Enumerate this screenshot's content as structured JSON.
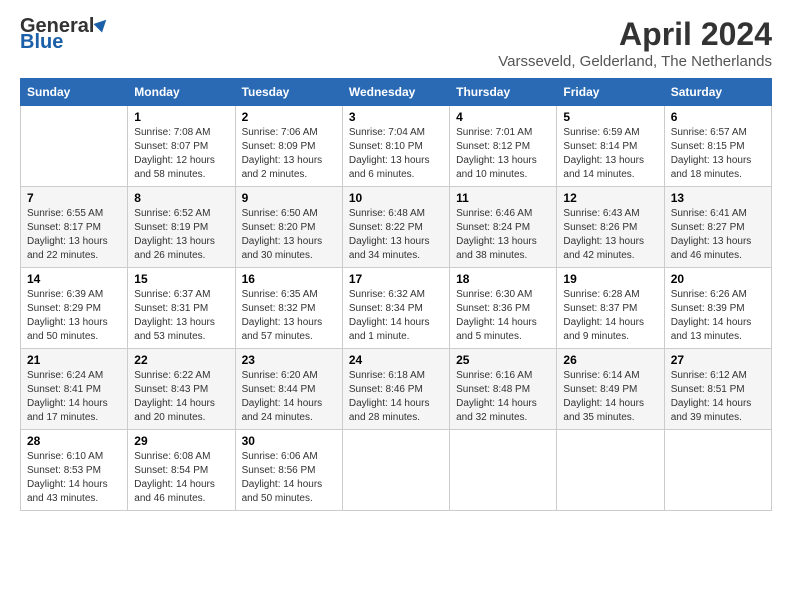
{
  "header": {
    "logo_general": "General",
    "logo_blue": "Blue",
    "title": "April 2024",
    "location": "Varsseveld, Gelderland, The Netherlands"
  },
  "days_of_week": [
    "Sunday",
    "Monday",
    "Tuesday",
    "Wednesday",
    "Thursday",
    "Friday",
    "Saturday"
  ],
  "weeks": [
    [
      {
        "day": "",
        "info": ""
      },
      {
        "day": "1",
        "info": "Sunrise: 7:08 AM\nSunset: 8:07 PM\nDaylight: 12 hours\nand 58 minutes."
      },
      {
        "day": "2",
        "info": "Sunrise: 7:06 AM\nSunset: 8:09 PM\nDaylight: 13 hours\nand 2 minutes."
      },
      {
        "day": "3",
        "info": "Sunrise: 7:04 AM\nSunset: 8:10 PM\nDaylight: 13 hours\nand 6 minutes."
      },
      {
        "day": "4",
        "info": "Sunrise: 7:01 AM\nSunset: 8:12 PM\nDaylight: 13 hours\nand 10 minutes."
      },
      {
        "day": "5",
        "info": "Sunrise: 6:59 AM\nSunset: 8:14 PM\nDaylight: 13 hours\nand 14 minutes."
      },
      {
        "day": "6",
        "info": "Sunrise: 6:57 AM\nSunset: 8:15 PM\nDaylight: 13 hours\nand 18 minutes."
      }
    ],
    [
      {
        "day": "7",
        "info": "Sunrise: 6:55 AM\nSunset: 8:17 PM\nDaylight: 13 hours\nand 22 minutes."
      },
      {
        "day": "8",
        "info": "Sunrise: 6:52 AM\nSunset: 8:19 PM\nDaylight: 13 hours\nand 26 minutes."
      },
      {
        "day": "9",
        "info": "Sunrise: 6:50 AM\nSunset: 8:20 PM\nDaylight: 13 hours\nand 30 minutes."
      },
      {
        "day": "10",
        "info": "Sunrise: 6:48 AM\nSunset: 8:22 PM\nDaylight: 13 hours\nand 34 minutes."
      },
      {
        "day": "11",
        "info": "Sunrise: 6:46 AM\nSunset: 8:24 PM\nDaylight: 13 hours\nand 38 minutes."
      },
      {
        "day": "12",
        "info": "Sunrise: 6:43 AM\nSunset: 8:26 PM\nDaylight: 13 hours\nand 42 minutes."
      },
      {
        "day": "13",
        "info": "Sunrise: 6:41 AM\nSunset: 8:27 PM\nDaylight: 13 hours\nand 46 minutes."
      }
    ],
    [
      {
        "day": "14",
        "info": "Sunrise: 6:39 AM\nSunset: 8:29 PM\nDaylight: 13 hours\nand 50 minutes."
      },
      {
        "day": "15",
        "info": "Sunrise: 6:37 AM\nSunset: 8:31 PM\nDaylight: 13 hours\nand 53 minutes."
      },
      {
        "day": "16",
        "info": "Sunrise: 6:35 AM\nSunset: 8:32 PM\nDaylight: 13 hours\nand 57 minutes."
      },
      {
        "day": "17",
        "info": "Sunrise: 6:32 AM\nSunset: 8:34 PM\nDaylight: 14 hours\nand 1 minute."
      },
      {
        "day": "18",
        "info": "Sunrise: 6:30 AM\nSunset: 8:36 PM\nDaylight: 14 hours\nand 5 minutes."
      },
      {
        "day": "19",
        "info": "Sunrise: 6:28 AM\nSunset: 8:37 PM\nDaylight: 14 hours\nand 9 minutes."
      },
      {
        "day": "20",
        "info": "Sunrise: 6:26 AM\nSunset: 8:39 PM\nDaylight: 14 hours\nand 13 minutes."
      }
    ],
    [
      {
        "day": "21",
        "info": "Sunrise: 6:24 AM\nSunset: 8:41 PM\nDaylight: 14 hours\nand 17 minutes."
      },
      {
        "day": "22",
        "info": "Sunrise: 6:22 AM\nSunset: 8:43 PM\nDaylight: 14 hours\nand 20 minutes."
      },
      {
        "day": "23",
        "info": "Sunrise: 6:20 AM\nSunset: 8:44 PM\nDaylight: 14 hours\nand 24 minutes."
      },
      {
        "day": "24",
        "info": "Sunrise: 6:18 AM\nSunset: 8:46 PM\nDaylight: 14 hours\nand 28 minutes."
      },
      {
        "day": "25",
        "info": "Sunrise: 6:16 AM\nSunset: 8:48 PM\nDaylight: 14 hours\nand 32 minutes."
      },
      {
        "day": "26",
        "info": "Sunrise: 6:14 AM\nSunset: 8:49 PM\nDaylight: 14 hours\nand 35 minutes."
      },
      {
        "day": "27",
        "info": "Sunrise: 6:12 AM\nSunset: 8:51 PM\nDaylight: 14 hours\nand 39 minutes."
      }
    ],
    [
      {
        "day": "28",
        "info": "Sunrise: 6:10 AM\nSunset: 8:53 PM\nDaylight: 14 hours\nand 43 minutes."
      },
      {
        "day": "29",
        "info": "Sunrise: 6:08 AM\nSunset: 8:54 PM\nDaylight: 14 hours\nand 46 minutes."
      },
      {
        "day": "30",
        "info": "Sunrise: 6:06 AM\nSunset: 8:56 PM\nDaylight: 14 hours\nand 50 minutes."
      },
      {
        "day": "",
        "info": ""
      },
      {
        "day": "",
        "info": ""
      },
      {
        "day": "",
        "info": ""
      },
      {
        "day": "",
        "info": ""
      }
    ]
  ]
}
